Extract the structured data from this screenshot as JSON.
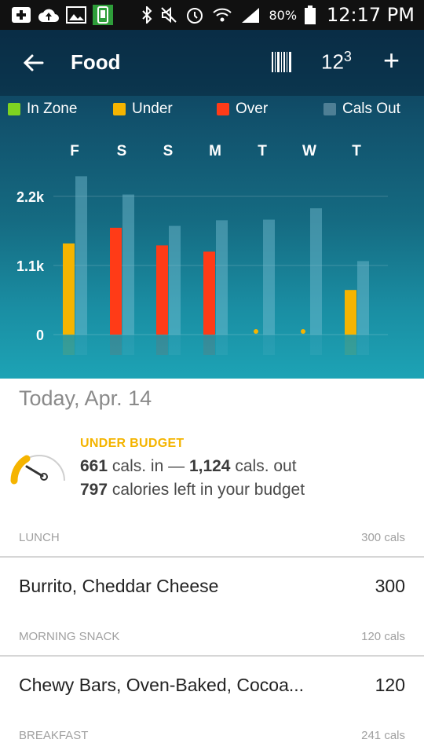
{
  "status_bar": {
    "left_icons": [
      "add-box-icon",
      "cloud-upload-icon",
      "image-icon",
      "phone-sync-icon"
    ],
    "right_icons": [
      "bluetooth-icon",
      "mute-icon",
      "alarm-icon",
      "wifi-icon",
      "signal-icon"
    ],
    "battery": "80%",
    "time": "12:17 PM"
  },
  "header": {
    "title": "Food",
    "numpad_label": "12",
    "numpad_sup": "3",
    "add_label": "+"
  },
  "legend": [
    {
      "label": "In Zone",
      "color": "#7ed321"
    },
    {
      "label": "Under",
      "color": "#f5b400"
    },
    {
      "label": "Over",
      "color": "#ff3b17"
    },
    {
      "label": "Cals Out",
      "color": "#4e7f95"
    }
  ],
  "chart_data": {
    "type": "bar",
    "categories": [
      "F",
      "S",
      "S",
      "M",
      "T",
      "W",
      "T"
    ],
    "y_tick_labels": [
      "2.2k",
      "1.1k",
      "0"
    ],
    "ylim": [
      0,
      2200
    ],
    "series": [
      {
        "name": "Cals Out",
        "values": [
          2520,
          2230,
          1730,
          1820,
          1830,
          2010,
          1170
        ]
      },
      {
        "name": "Cals In",
        "values": [
          1450,
          1700,
          1420,
          1320,
          0,
          0,
          710
        ],
        "status": [
          "Under",
          "Over",
          "Over",
          "Over",
          "Under",
          "Under",
          "Under"
        ]
      }
    ]
  },
  "today": {
    "date": "Today, Apr. 14",
    "status": "UNDER BUDGET",
    "cals_in": "661",
    "cals_in_label": "cals. in —",
    "cals_out": "1,124",
    "cals_out_label": "cals. out",
    "left": "797",
    "left_label": "calories left in your budget"
  },
  "meals": [
    {
      "name": "LUNCH",
      "cals": "300 cals",
      "items": [
        {
          "name": "Burrito, Cheddar Cheese",
          "cals": "300"
        }
      ]
    },
    {
      "name": "MORNING SNACK",
      "cals": "120 cals",
      "items": [
        {
          "name": "Chewy Bars, Oven-Baked, Cocoa...",
          "cals": "120"
        }
      ]
    },
    {
      "name": "BREAKFAST",
      "cals": "241 cals",
      "items": []
    }
  ]
}
